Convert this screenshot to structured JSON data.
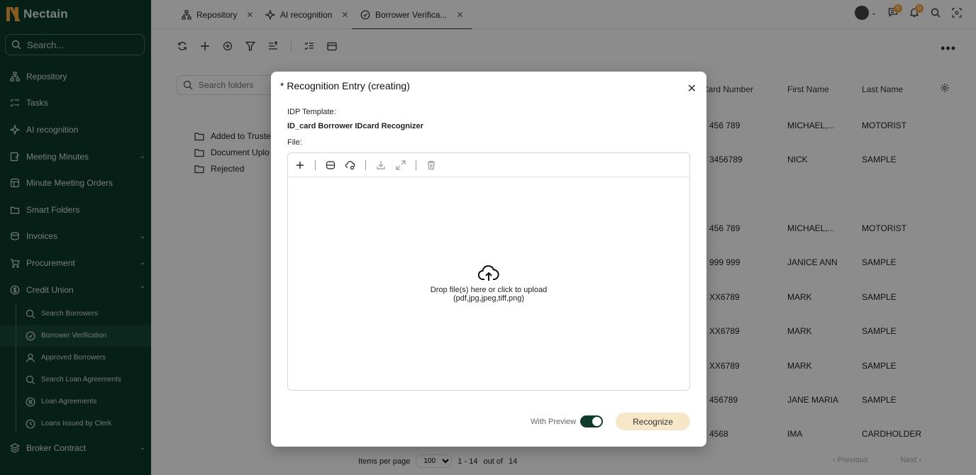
{
  "app": {
    "name": "Nectain"
  },
  "sidebar": {
    "search_placeholder": "Search...",
    "items": [
      {
        "label": "Repository"
      },
      {
        "label": "Tasks"
      },
      {
        "label": "AI recognition"
      },
      {
        "label": "Meeting Minutes"
      },
      {
        "label": "Minute Meeting Orders"
      },
      {
        "label": "Smart Folders"
      },
      {
        "label": "Invoices"
      },
      {
        "label": "Procurement"
      },
      {
        "label": "Credit Union"
      }
    ],
    "sub_items": [
      {
        "label": "Search Borrowers"
      },
      {
        "label": "Borrower Verification"
      },
      {
        "label": "Approved Borrowers"
      },
      {
        "label": "Search Loan Agreements"
      },
      {
        "label": "Loan Agreements"
      },
      {
        "label": "Loans Issued by Clerk"
      }
    ],
    "last_item": {
      "label": "Broker Contract"
    }
  },
  "tabs": [
    {
      "label": "Repository"
    },
    {
      "label": "AI recognition"
    },
    {
      "label": "Borrower Verifica..."
    }
  ],
  "header": {
    "messages_count": "0",
    "notifications_count": "0"
  },
  "folders": {
    "search_placeholder": "Search folders",
    "items": [
      {
        "label": "Added to Truste"
      },
      {
        "label": "Document Uplo"
      },
      {
        "label": "Rejected"
      }
    ]
  },
  "table": {
    "columns": [
      "Card Number",
      "First Name",
      "Last Name"
    ],
    "rows": [
      {
        "card": "456 789",
        "first": "MICHAEL,...",
        "last": "MOTORIST"
      },
      {
        "card": "3456789",
        "first": "NICK",
        "last": "SAMPLE"
      },
      {
        "card": "456 789",
        "first": "MICHAEL,...",
        "last": "MOTORIST"
      },
      {
        "card": "999 999",
        "first": "JANICE ANN",
        "last": "SAMPLE"
      },
      {
        "card": "XX6789",
        "first": "MARK",
        "last": "SAMPLE"
      },
      {
        "card": "XX6789",
        "first": "MARK",
        "last": "SAMPLE"
      },
      {
        "card": "XX6789",
        "first": "MARK",
        "last": "SAMPLE"
      },
      {
        "card": "456789",
        "first": "JANE MARIA",
        "last": "SAMPLE"
      },
      {
        "card": "4568",
        "first": "IMA",
        "last": "CARDHOLDER"
      }
    ]
  },
  "pagination": {
    "items_per_page_label": "Items per page",
    "page_size": "100",
    "range": "1 - 14",
    "out_of_label": "out of",
    "total": "14",
    "previous": "Previous",
    "next": "Next"
  },
  "modal": {
    "title": "* Recognition Entry (creating)",
    "idp_label": "IDP Template:",
    "idp_value": "ID_card Borrower IDcard Recognizer",
    "file_label": "File:",
    "drop_text": "Drop file(s) here or click to upload",
    "drop_formats": "(pdf,jpg,jpeg,tiff,png)",
    "with_preview_label": "With Preview",
    "with_preview_on": true,
    "recognize_label": "Recognize"
  }
}
